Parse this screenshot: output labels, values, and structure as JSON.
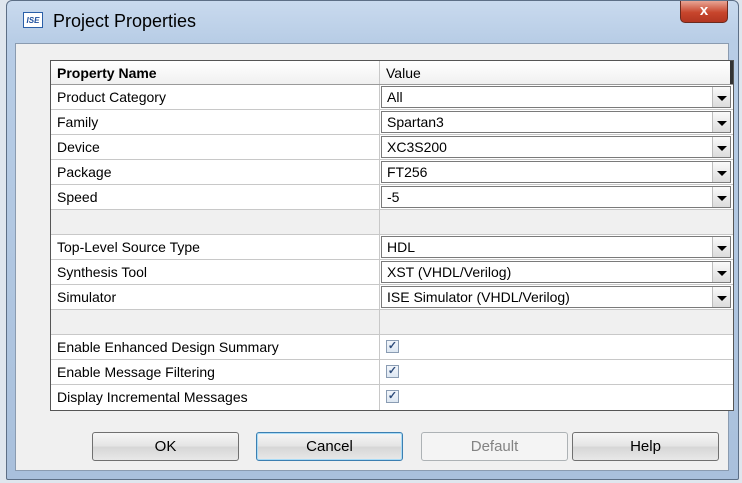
{
  "window": {
    "title": "Project Properties",
    "app_icon_text": "ISE",
    "close_glyph": "x"
  },
  "grid": {
    "header": {
      "name": "Property Name",
      "value": "Value"
    },
    "rows": [
      {
        "name": "Product Category",
        "value": "All",
        "kind": "dropdown"
      },
      {
        "name": "Family",
        "value": "Spartan3",
        "kind": "dropdown"
      },
      {
        "name": "Device",
        "value": "XC3S200",
        "kind": "dropdown"
      },
      {
        "name": "Package",
        "value": "FT256",
        "kind": "dropdown"
      },
      {
        "name": "Speed",
        "value": "-5",
        "kind": "dropdown"
      },
      {
        "name": "",
        "value": "",
        "kind": "spacer"
      },
      {
        "name": "Top-Level Source Type",
        "value": "HDL",
        "kind": "dropdown"
      },
      {
        "name": "Synthesis Tool",
        "value": "XST (VHDL/Verilog)",
        "kind": "dropdown"
      },
      {
        "name": "Simulator",
        "value": "ISE Simulator (VHDL/Verilog)",
        "kind": "dropdown"
      },
      {
        "name": "",
        "value": "",
        "kind": "spacer"
      },
      {
        "name": "Enable Enhanced Design Summary",
        "checked": true,
        "kind": "checkbox"
      },
      {
        "name": "Enable Message Filtering",
        "checked": true,
        "kind": "checkbox"
      },
      {
        "name": "Display Incremental Messages",
        "checked": true,
        "kind": "checkbox"
      }
    ]
  },
  "buttons": {
    "ok": "OK",
    "cancel": "Cancel",
    "default": "Default",
    "help": "Help"
  },
  "colors": {
    "title_bar": "#b8cde6",
    "close_button": "#c7452c",
    "focus_border": "#3c7fb1"
  }
}
